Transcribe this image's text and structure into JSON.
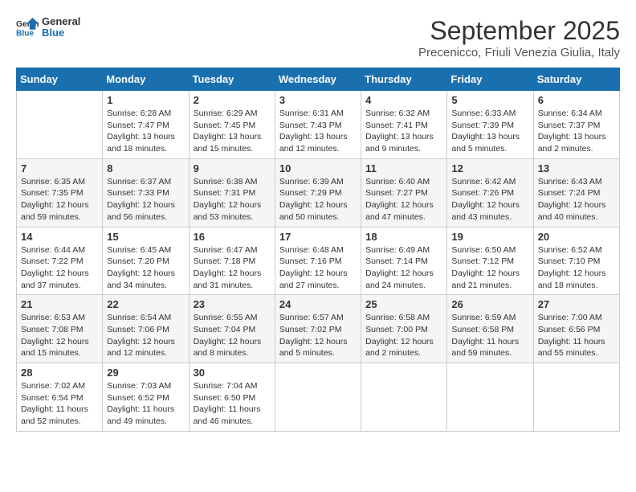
{
  "header": {
    "logo_line1": "General",
    "logo_line2": "Blue",
    "month": "September 2025",
    "location": "Precenicco, Friuli Venezia Giulia, Italy"
  },
  "days_of_week": [
    "Sunday",
    "Monday",
    "Tuesday",
    "Wednesday",
    "Thursday",
    "Friday",
    "Saturday"
  ],
  "weeks": [
    [
      {
        "day": "",
        "info": ""
      },
      {
        "day": "1",
        "info": "Sunrise: 6:28 AM\nSunset: 7:47 PM\nDaylight: 13 hours\nand 18 minutes."
      },
      {
        "day": "2",
        "info": "Sunrise: 6:29 AM\nSunset: 7:45 PM\nDaylight: 13 hours\nand 15 minutes."
      },
      {
        "day": "3",
        "info": "Sunrise: 6:31 AM\nSunset: 7:43 PM\nDaylight: 13 hours\nand 12 minutes."
      },
      {
        "day": "4",
        "info": "Sunrise: 6:32 AM\nSunset: 7:41 PM\nDaylight: 13 hours\nand 9 minutes."
      },
      {
        "day": "5",
        "info": "Sunrise: 6:33 AM\nSunset: 7:39 PM\nDaylight: 13 hours\nand 5 minutes."
      },
      {
        "day": "6",
        "info": "Sunrise: 6:34 AM\nSunset: 7:37 PM\nDaylight: 13 hours\nand 2 minutes."
      }
    ],
    [
      {
        "day": "7",
        "info": "Sunrise: 6:35 AM\nSunset: 7:35 PM\nDaylight: 12 hours\nand 59 minutes."
      },
      {
        "day": "8",
        "info": "Sunrise: 6:37 AM\nSunset: 7:33 PM\nDaylight: 12 hours\nand 56 minutes."
      },
      {
        "day": "9",
        "info": "Sunrise: 6:38 AM\nSunset: 7:31 PM\nDaylight: 12 hours\nand 53 minutes."
      },
      {
        "day": "10",
        "info": "Sunrise: 6:39 AM\nSunset: 7:29 PM\nDaylight: 12 hours\nand 50 minutes."
      },
      {
        "day": "11",
        "info": "Sunrise: 6:40 AM\nSunset: 7:27 PM\nDaylight: 12 hours\nand 47 minutes."
      },
      {
        "day": "12",
        "info": "Sunrise: 6:42 AM\nSunset: 7:26 PM\nDaylight: 12 hours\nand 43 minutes."
      },
      {
        "day": "13",
        "info": "Sunrise: 6:43 AM\nSunset: 7:24 PM\nDaylight: 12 hours\nand 40 minutes."
      }
    ],
    [
      {
        "day": "14",
        "info": "Sunrise: 6:44 AM\nSunset: 7:22 PM\nDaylight: 12 hours\nand 37 minutes."
      },
      {
        "day": "15",
        "info": "Sunrise: 6:45 AM\nSunset: 7:20 PM\nDaylight: 12 hours\nand 34 minutes."
      },
      {
        "day": "16",
        "info": "Sunrise: 6:47 AM\nSunset: 7:18 PM\nDaylight: 12 hours\nand 31 minutes."
      },
      {
        "day": "17",
        "info": "Sunrise: 6:48 AM\nSunset: 7:16 PM\nDaylight: 12 hours\nand 27 minutes."
      },
      {
        "day": "18",
        "info": "Sunrise: 6:49 AM\nSunset: 7:14 PM\nDaylight: 12 hours\nand 24 minutes."
      },
      {
        "day": "19",
        "info": "Sunrise: 6:50 AM\nSunset: 7:12 PM\nDaylight: 12 hours\nand 21 minutes."
      },
      {
        "day": "20",
        "info": "Sunrise: 6:52 AM\nSunset: 7:10 PM\nDaylight: 12 hours\nand 18 minutes."
      }
    ],
    [
      {
        "day": "21",
        "info": "Sunrise: 6:53 AM\nSunset: 7:08 PM\nDaylight: 12 hours\nand 15 minutes."
      },
      {
        "day": "22",
        "info": "Sunrise: 6:54 AM\nSunset: 7:06 PM\nDaylight: 12 hours\nand 12 minutes."
      },
      {
        "day": "23",
        "info": "Sunrise: 6:55 AM\nSunset: 7:04 PM\nDaylight: 12 hours\nand 8 minutes."
      },
      {
        "day": "24",
        "info": "Sunrise: 6:57 AM\nSunset: 7:02 PM\nDaylight: 12 hours\nand 5 minutes."
      },
      {
        "day": "25",
        "info": "Sunrise: 6:58 AM\nSunset: 7:00 PM\nDaylight: 12 hours\nand 2 minutes."
      },
      {
        "day": "26",
        "info": "Sunrise: 6:59 AM\nSunset: 6:58 PM\nDaylight: 11 hours\nand 59 minutes."
      },
      {
        "day": "27",
        "info": "Sunrise: 7:00 AM\nSunset: 6:56 PM\nDaylight: 11 hours\nand 55 minutes."
      }
    ],
    [
      {
        "day": "28",
        "info": "Sunrise: 7:02 AM\nSunset: 6:54 PM\nDaylight: 11 hours\nand 52 minutes."
      },
      {
        "day": "29",
        "info": "Sunrise: 7:03 AM\nSunset: 6:52 PM\nDaylight: 11 hours\nand 49 minutes."
      },
      {
        "day": "30",
        "info": "Sunrise: 7:04 AM\nSunset: 6:50 PM\nDaylight: 11 hours\nand 46 minutes."
      },
      {
        "day": "",
        "info": ""
      },
      {
        "day": "",
        "info": ""
      },
      {
        "day": "",
        "info": ""
      },
      {
        "day": "",
        "info": ""
      }
    ]
  ]
}
